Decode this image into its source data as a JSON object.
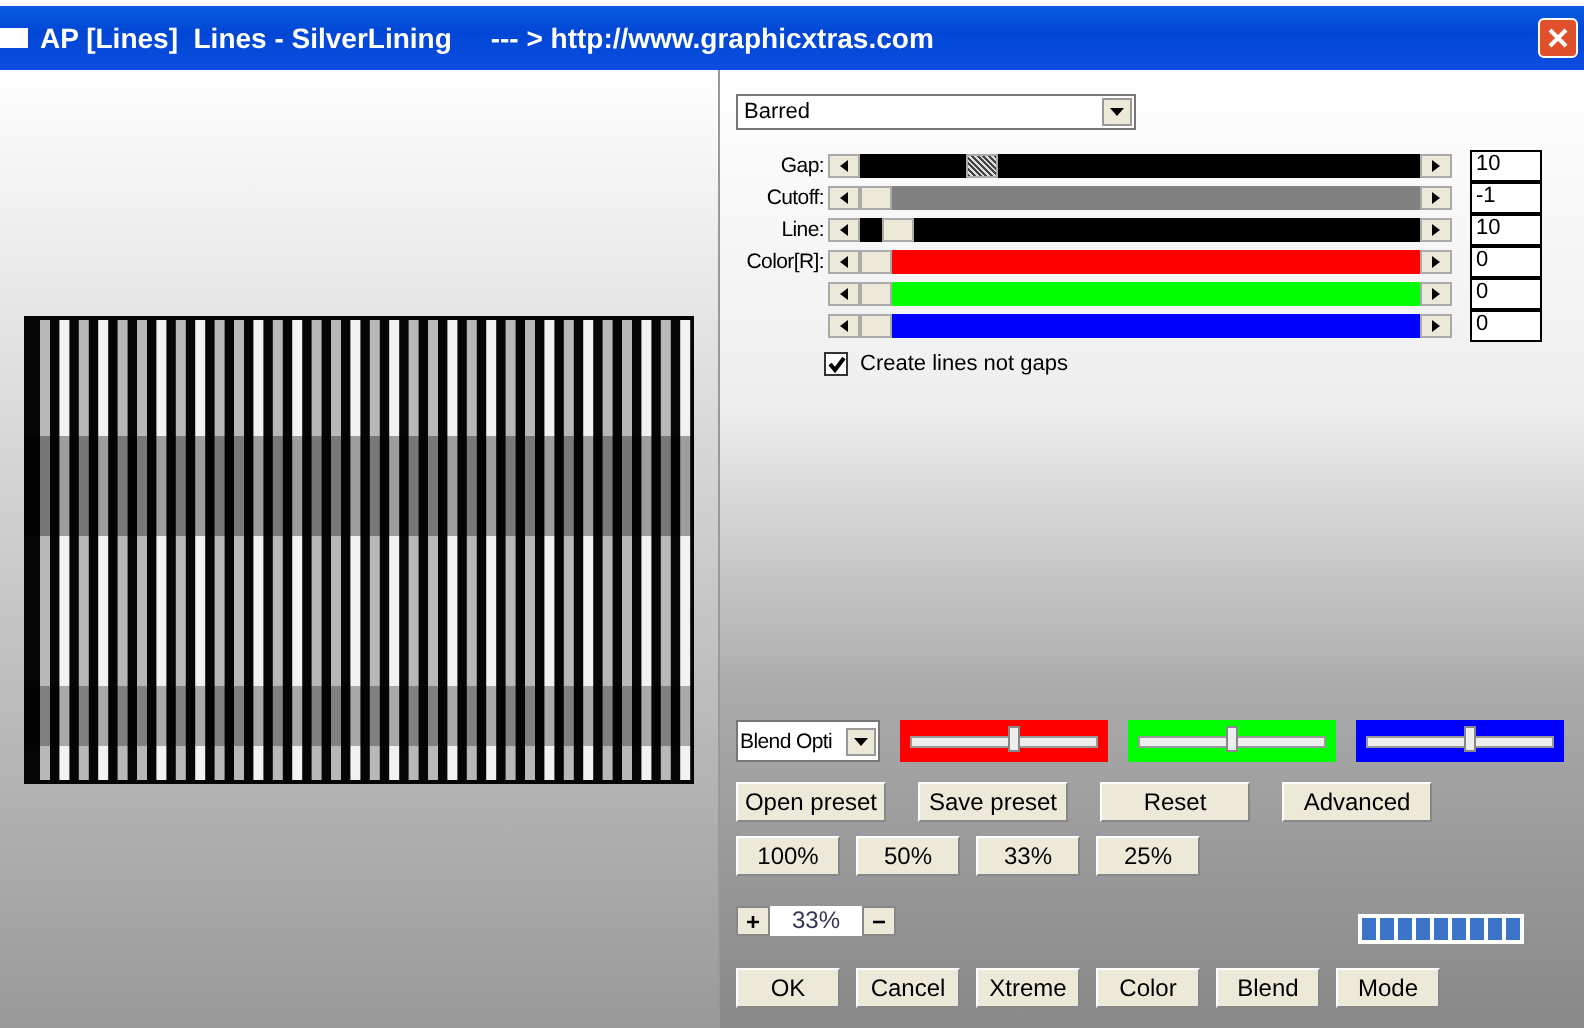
{
  "window": {
    "title": "AP [Lines]  Lines - SilverLining     --- > http://www.graphicxtras.com"
  },
  "preset_dropdown": {
    "value": "Barred"
  },
  "sliders": [
    {
      "label": "Gap:",
      "kind": "hatched",
      "color": "#000000",
      "level": 0.2,
      "value": "10"
    },
    {
      "label": "Cutoff:",
      "kind": "plain",
      "color": "#808080",
      "level": 0,
      "value": "-1"
    },
    {
      "label": "Line:",
      "kind": "plain",
      "color": "#000000",
      "level": 0.04,
      "value": "10"
    },
    {
      "label": "Color[R]:",
      "kind": "plain",
      "color": "#ff0000",
      "level": 0,
      "value": "0"
    },
    {
      "kind": "plain",
      "color": "#00ff00",
      "level": 0,
      "value": "0"
    },
    {
      "kind": "plain",
      "color": "#0000ff",
      "level": 0,
      "value": "0"
    }
  ],
  "checkbox": {
    "label": "Create lines not gaps",
    "checked": true
  },
  "blend_dropdown": {
    "value": "Blend Opti"
  },
  "blend_sliders": [
    {
      "color": "#ff0000",
      "level": 0.55
    },
    {
      "color": "#00ff00",
      "level": 0.5
    },
    {
      "color": "#0000ff",
      "level": 0.55
    }
  ],
  "preset_buttons": [
    "Open preset",
    "Save preset",
    "Reset",
    "Advanced"
  ],
  "zoom_buttons": [
    "100%",
    "50%",
    "33%",
    "25%"
  ],
  "zoom": {
    "increase": "+",
    "value": "33%",
    "decrease": "−"
  },
  "action_buttons": [
    "OK",
    "Cancel",
    "Xtreme",
    "Color",
    "Blend",
    "Mode"
  ]
}
